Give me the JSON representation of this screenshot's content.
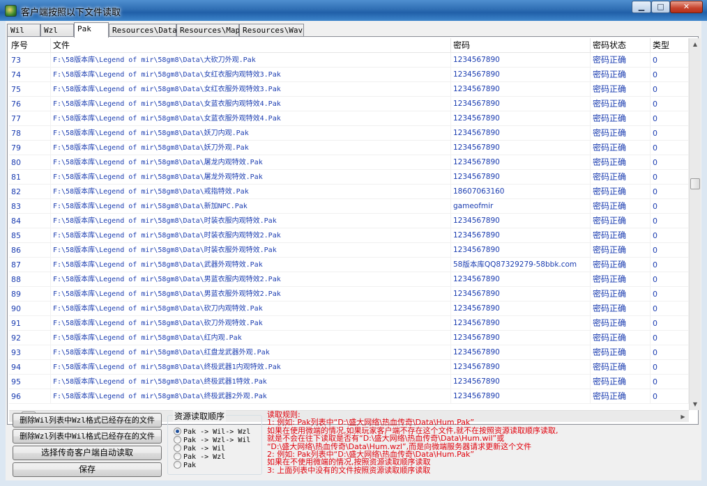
{
  "window": {
    "title": "客户端按照以下文件读取",
    "min_glyph": "▁",
    "max_glyph": "□",
    "close_glyph": "✕"
  },
  "tabs": [
    "Wil",
    "Wzl",
    "Pak",
    "Resources\\Data",
    "Resources\\Map",
    "Resources\\Wav"
  ],
  "active_tab": "Pak",
  "table": {
    "headers": {
      "index": "序号",
      "file": "文件",
      "password": "密码",
      "status": "密码状态",
      "type": "类型"
    },
    "rows": [
      {
        "index": "73",
        "file": "F:\\58版本库\\Legend of mir\\58gm8\\Data\\大砍刀外观.Pak",
        "password": "1234567890",
        "status": "密码正确",
        "type": "0"
      },
      {
        "index": "74",
        "file": "F:\\58版本库\\Legend of mir\\58gm8\\Data\\女红衣服内观特效3.Pak",
        "password": "1234567890",
        "status": "密码正确",
        "type": "0"
      },
      {
        "index": "75",
        "file": "F:\\58版本库\\Legend of mir\\58gm8\\Data\\女红衣服外观特效3.Pak",
        "password": "1234567890",
        "status": "密码正确",
        "type": "0"
      },
      {
        "index": "76",
        "file": "F:\\58版本库\\Legend of mir\\58gm8\\Data\\女蓝衣服内观特效4.Pak",
        "password": "1234567890",
        "status": "密码正确",
        "type": "0"
      },
      {
        "index": "77",
        "file": "F:\\58版本库\\Legend of mir\\58gm8\\Data\\女蓝衣服外观特效4.Pak",
        "password": "1234567890",
        "status": "密码正确",
        "type": "0"
      },
      {
        "index": "78",
        "file": "F:\\58版本库\\Legend of mir\\58gm8\\Data\\妖刀内观.Pak",
        "password": "1234567890",
        "status": "密码正确",
        "type": "0"
      },
      {
        "index": "79",
        "file": "F:\\58版本库\\Legend of mir\\58gm8\\Data\\妖刀外观.Pak",
        "password": "1234567890",
        "status": "密码正确",
        "type": "0"
      },
      {
        "index": "80",
        "file": "F:\\58版本库\\Legend of mir\\58gm8\\Data\\屠龙内观特效.Pak",
        "password": "1234567890",
        "status": "密码正确",
        "type": "0"
      },
      {
        "index": "81",
        "file": "F:\\58版本库\\Legend of mir\\58gm8\\Data\\屠龙外观特效.Pak",
        "password": "1234567890",
        "status": "密码正确",
        "type": "0"
      },
      {
        "index": "82",
        "file": "F:\\58版本库\\Legend of mir\\58gm8\\Data\\戒指特效.Pak",
        "password": "18607063160",
        "status": "密码正确",
        "type": "0"
      },
      {
        "index": "83",
        "file": "F:\\58版本库\\Legend of mir\\58gm8\\Data\\新加NPC.Pak",
        "password": "gameofmir",
        "status": "密码正确",
        "type": "0"
      },
      {
        "index": "84",
        "file": "F:\\58版本库\\Legend of mir\\58gm8\\Data\\时装衣服内观特效.Pak",
        "password": "1234567890",
        "status": "密码正确",
        "type": "0"
      },
      {
        "index": "85",
        "file": "F:\\58版本库\\Legend of mir\\58gm8\\Data\\时装衣服内观特效2.Pak",
        "password": "1234567890",
        "status": "密码正确",
        "type": "0"
      },
      {
        "index": "86",
        "file": "F:\\58版本库\\Legend of mir\\58gm8\\Data\\时装衣服外观特效.Pak",
        "password": "1234567890",
        "status": "密码正确",
        "type": "0"
      },
      {
        "index": "87",
        "file": "F:\\58版本库\\Legend of mir\\58gm8\\Data\\武器外观特效.Pak",
        "password": "58版本库QQ87329279-58bbk.com",
        "status": "密码正确",
        "type": "0"
      },
      {
        "index": "88",
        "file": "F:\\58版本库\\Legend of mir\\58gm8\\Data\\男蓝衣服内观特效2.Pak",
        "password": "1234567890",
        "status": "密码正确",
        "type": "0"
      },
      {
        "index": "89",
        "file": "F:\\58版本库\\Legend of mir\\58gm8\\Data\\男蓝衣服外观特效2.Pak",
        "password": "1234567890",
        "status": "密码正确",
        "type": "0"
      },
      {
        "index": "90",
        "file": "F:\\58版本库\\Legend of mir\\58gm8\\Data\\砍刀内观特效.Pak",
        "password": "1234567890",
        "status": "密码正确",
        "type": "0"
      },
      {
        "index": "91",
        "file": "F:\\58版本库\\Legend of mir\\58gm8\\Data\\砍刀外观特效.Pak",
        "password": "1234567890",
        "status": "密码正确",
        "type": "0"
      },
      {
        "index": "92",
        "file": "F:\\58版本库\\Legend of mir\\58gm8\\Data\\红内观.Pak",
        "password": "1234567890",
        "status": "密码正确",
        "type": "0"
      },
      {
        "index": "93",
        "file": "F:\\58版本库\\Legend of mir\\58gm8\\Data\\红盘龙武器外观.Pak",
        "password": "1234567890",
        "status": "密码正确",
        "type": "0"
      },
      {
        "index": "94",
        "file": "F:\\58版本库\\Legend of mir\\58gm8\\Data\\终极武器1内观特效.Pak",
        "password": "1234567890",
        "status": "密码正确",
        "type": "0"
      },
      {
        "index": "95",
        "file": "F:\\58版本库\\Legend of mir\\58gm8\\Data\\终极武器1特效.Pak",
        "password": "1234567890",
        "status": "密码正确",
        "type": "0"
      },
      {
        "index": "96",
        "file": "F:\\58版本库\\Legend of mir\\58gm8\\Data\\终极武器2外观.Pak",
        "password": "1234567890",
        "status": "密码正确",
        "type": "0"
      }
    ]
  },
  "buttons": {
    "delete_wil": "删除Wil列表中Wzl格式已经存在的文件",
    "delete_wzl": "删除Wzl列表中Wil格式已经存在的文件",
    "select_client": "选择传奇客户端自动读取",
    "save": "保存"
  },
  "load_order": {
    "title": "资源读取顺序",
    "options": [
      "Pak -> Wil-> Wzl",
      "Pak -> Wzl-> Wil",
      "Pak -> Wil",
      "Pak -> Wzl",
      "Pak"
    ],
    "selected_index": 0
  },
  "rules": [
    "读取规则:",
    "1: 例如: Pak列表中“D:\\盛大网络\\热血传奇\\Data\\Hum.Pak”",
    "      如果在使用微端的情况,如果玩家客户端不存在这个文件,就不在按照资源读取顺序读取,",
    "      就是不会在往下读取是否有“D:\\盛大网络\\热血传奇\\Data\\Hum.wil”或",
    "      “D:\\盛大网络\\热血传奇\\Data\\Hum.wzl”,而是向微端服务器请求更新这个文件",
    "2: 例如: Pak列表中“D:\\盛大网络\\热血传奇\\Data\\Hum.Pak”",
    "      如果在不使用微端的情况,按照资源读取顺序读取",
    "3: 上面列表中没有的文件按照资源读取顺序读取"
  ],
  "colors": {
    "row_text": "#1a3cb0",
    "rules_text": "#e0000b"
  }
}
